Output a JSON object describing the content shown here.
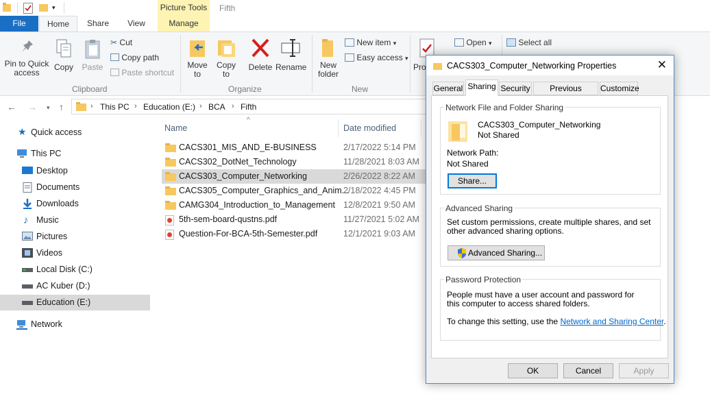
{
  "titlebar": {
    "picture_tools": "Picture Tools",
    "window_title": "Fifth"
  },
  "tabs": {
    "file": "File",
    "home": "Home",
    "share": "Share",
    "view": "View",
    "manage": "Manage"
  },
  "ribbon": {
    "pin": "Pin to Quick access",
    "copy": "Copy",
    "paste": "Paste",
    "cut": "Cut",
    "copy_path": "Copy path",
    "paste_shortcut": "Paste shortcut",
    "clipboard": "Clipboard",
    "move_to": "Move to",
    "copy_to": "Copy to",
    "delete": "Delete",
    "rename": "Rename",
    "organize": "Organize",
    "new_folder": "New folder",
    "new_item": "New item",
    "easy_access": "Easy access",
    "new": "New",
    "properties": "Properties",
    "open": "Open",
    "select_all": "Select all"
  },
  "address": {
    "crumbs": [
      "This PC",
      "Education (E:)",
      "BCA",
      "Fifth"
    ]
  },
  "nav": {
    "items": [
      "Quick access",
      "This PC",
      "Desktop",
      "Documents",
      "Downloads",
      "Music",
      "Pictures",
      "Videos",
      "Local Disk (C:)",
      "AC Kuber (D:)",
      "Education (E:)",
      "Network"
    ]
  },
  "filelist": {
    "columns": {
      "name": "Name",
      "date": "Date modified"
    },
    "rows": [
      {
        "name": "CACS301_MIS_AND_E-BUSINESS",
        "date": "2/17/2022 5:14 PM",
        "type": "folder"
      },
      {
        "name": "CACS302_DotNet_Technology",
        "date": "11/28/2021 8:03 AM",
        "type": "folder"
      },
      {
        "name": "CACS303_Computer_Networking",
        "date": "2/26/2022 8:22 AM",
        "type": "folder",
        "selected": true
      },
      {
        "name": "CACS305_Computer_Graphics_and_Anim...",
        "date": "2/18/2022 4:45 PM",
        "type": "folder"
      },
      {
        "name": "CAMG304_Introduction_to_Management",
        "date": "12/8/2021 9:50 AM",
        "type": "folder"
      },
      {
        "name": "5th-sem-board-qustns.pdf",
        "date": "11/27/2021 5:02 AM",
        "type": "pdf"
      },
      {
        "name": "Question-For-BCA-5th-Semester.pdf",
        "date": "12/1/2021 9:03 AM",
        "type": "pdf"
      }
    ]
  },
  "dialog": {
    "title": "CACS303_Computer_Networking Properties",
    "tabs": [
      "General",
      "Sharing",
      "Security",
      "Previous Versions",
      "Customize"
    ],
    "nfs": {
      "legend": "Network File and Folder Sharing",
      "folder_name": "CACS303_Computer_Networking",
      "status": "Not Shared",
      "path_label": "Network Path:",
      "path_value": "Not Shared",
      "share_button": "Share..."
    },
    "adv": {
      "legend": "Advanced Sharing",
      "text": "Set custom permissions, create multiple shares, and set other advanced sharing options.",
      "button": "Advanced Sharing..."
    },
    "pwd": {
      "legend": "Password Protection",
      "text": "People must have a user account and password for this computer to access shared folders.",
      "change_prefix": "To change this setting, use the ",
      "link": "Network and Sharing Center",
      "suffix": "."
    },
    "ok": "OK",
    "cancel": "Cancel",
    "apply": "Apply"
  },
  "colors": {
    "accent": "#1a6fc4",
    "selection": "#d9d9d9",
    "folder": "#f6c85f",
    "picture_tools_bg": "#fdf3b3",
    "link": "#0066cc"
  }
}
